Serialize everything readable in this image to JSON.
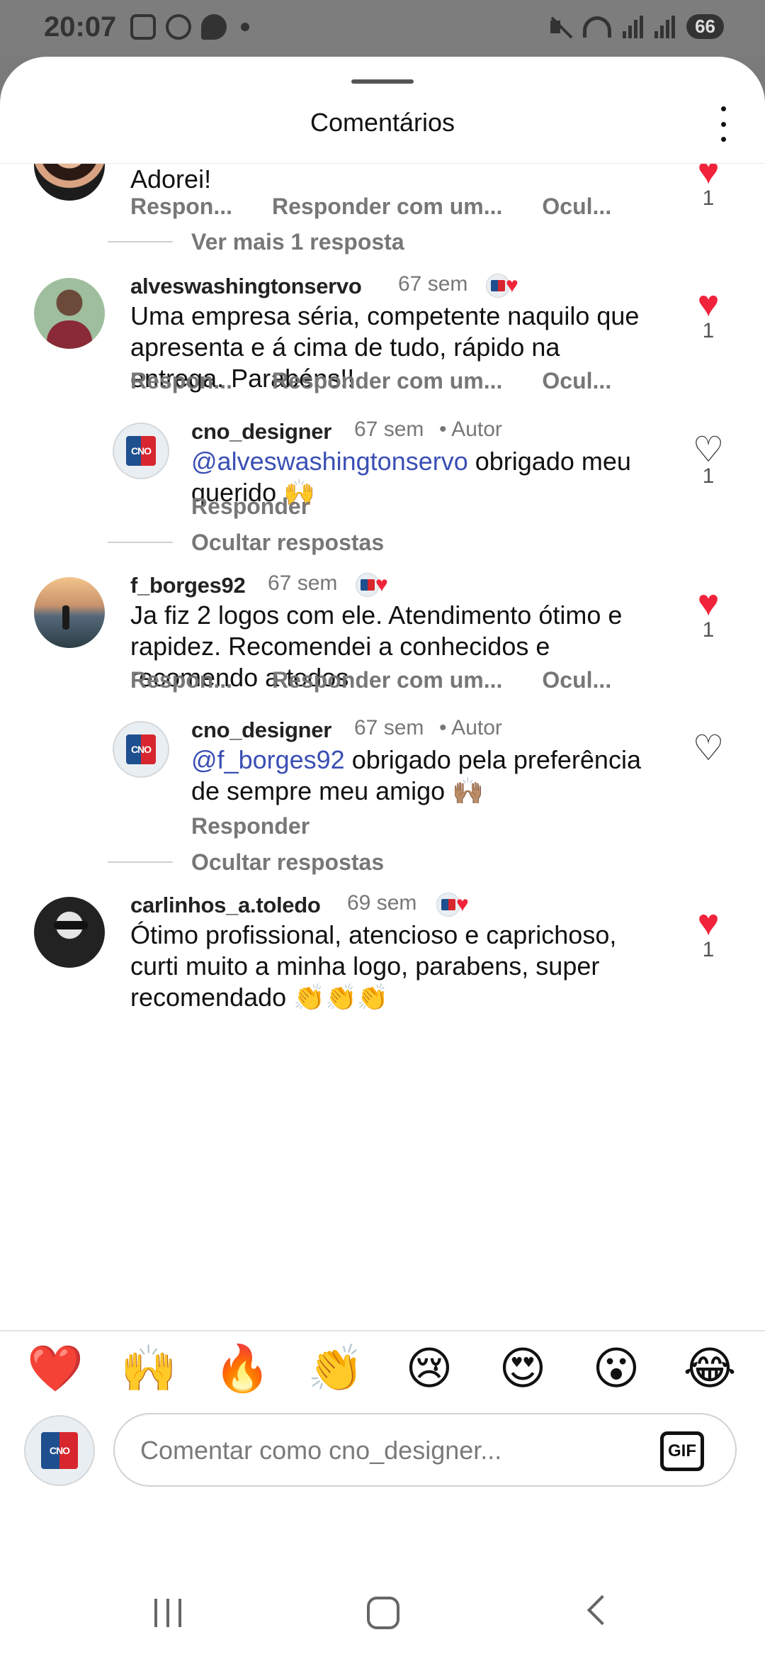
{
  "status_bar": {
    "time": "20:07",
    "battery": "66",
    "icons_left": [
      "screenshot-icon",
      "whatsapp-icon",
      "message-icon",
      "dot-icon"
    ],
    "icons_right": [
      "mute-icon",
      "wifi-icon",
      "signal-icon",
      "signal-icon"
    ]
  },
  "sheet": {
    "title": "Comentários",
    "more_icon": "more-vertical-icon"
  },
  "comments": [
    {
      "username": "",
      "text": "Adorei!",
      "actions": [
        "Respon...",
        "Responder com um...",
        "Ocul..."
      ],
      "liked": true,
      "likes": "1"
    },
    {
      "thread_toggle": "Ver mais 1 resposta"
    },
    {
      "username": "alveswashingtonservo",
      "time": "67 sem",
      "text": "Uma empresa séria, competente naquilo que apresenta e á cima de tudo, rápido na entrega. Parabéns!!",
      "actions": [
        "Respon...",
        "Responder com um...",
        "Ocul..."
      ],
      "liked": true,
      "likes": "1"
    },
    {
      "username": "cno_designer",
      "time": "67 sem",
      "author_tag": "• Autor",
      "mention": "@alveswashingtonservo",
      "text": " obrigado meu querido 🙌",
      "action": "Responder",
      "liked": false,
      "likes": "1"
    },
    {
      "thread_toggle": "Ocultar respostas"
    },
    {
      "username": "f_borges92",
      "time": "67 sem",
      "text": "Ja fiz 2 logos com ele. Atendimento ótimo e rapidez. Recomendei a conhecidos e recomendo a todos",
      "actions": [
        "Respon...",
        "Responder com um...",
        "Ocul..."
      ],
      "liked": true,
      "likes": "1"
    },
    {
      "username": "cno_designer",
      "time": "67 sem",
      "author_tag": "• Autor",
      "mention": "@f_borges92",
      "text": " obrigado pela preferência de sempre meu amigo 🙌🏽",
      "action": "Responder",
      "liked": false
    },
    {
      "thread_toggle": "Ocultar respostas"
    },
    {
      "username": "carlinhos_a.toledo",
      "time": "69 sem",
      "text": "Ótimo profissional, atencioso e caprichoso, curti muito a minha logo, parabens, super recomendado 👏👏👏",
      "liked": true,
      "likes": "1"
    }
  ],
  "reactions": [
    "❤️",
    "🙌",
    "🔥",
    "👏",
    "😢",
    "😍",
    "😮",
    "😂"
  ],
  "composer": {
    "placeholder": "Comentar como cno_designer...",
    "gif_label": "GIF"
  },
  "logo_text": "CNO"
}
